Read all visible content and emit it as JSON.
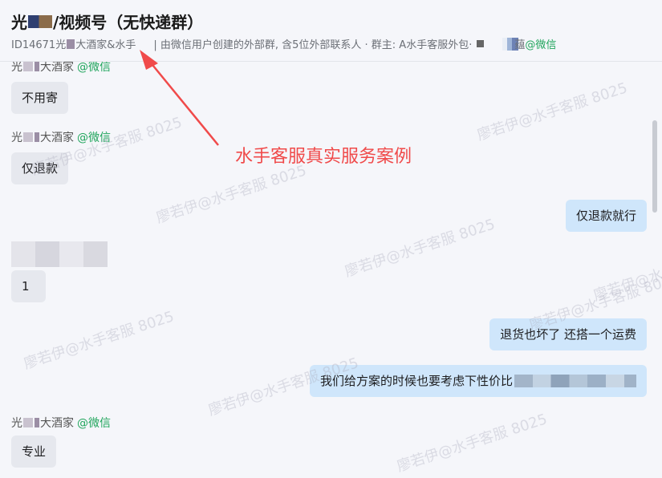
{
  "header": {
    "title_prefix": "光",
    "title_suffix": "/视频号（无快递群）",
    "subtitle_id": "ID14671光",
    "subtitle_mid": "大酒家&水手",
    "subtitle_desc": "| 由微信用户创建的外部群, 含5位外部联系人 · 群主: A水手客服外包·",
    "subtitle_tail_char": "蕴",
    "subtitle_wechat": "@微信"
  },
  "messages": [
    {
      "side": "left",
      "sender_prefix": "光",
      "sender_suffix": "大酒家",
      "sender_app": "@微信",
      "text": "不用寄"
    },
    {
      "side": "left",
      "sender_prefix": "光",
      "sender_suffix": "大酒家",
      "sender_app": "@微信",
      "text": "仅退款"
    },
    {
      "side": "right",
      "text": "仅退款就行"
    },
    {
      "side": "left",
      "sender_prefix": "",
      "sender_suffix": "",
      "sender_app": "",
      "text": "1"
    },
    {
      "side": "right",
      "text": "退货也坏了 还搭一个运费"
    },
    {
      "side": "right",
      "text": "我们给方案的时候也要考虑下性价比"
    },
    {
      "side": "left",
      "sender_prefix": "光",
      "sender_suffix": "大酒家",
      "sender_app": "@微信",
      "text": "专业"
    }
  ],
  "annotation": {
    "text": "水手客服真实服务案例",
    "color": "#f04a4a"
  },
  "watermark": {
    "text": "廖若伊@水手客服 8025"
  },
  "colors": {
    "bubble_right": "#cfe6fb",
    "bubble_left": "#e6e8ee",
    "wechat_green": "#20a55c"
  }
}
